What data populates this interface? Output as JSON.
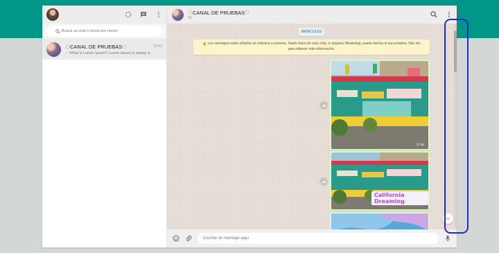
{
  "sidebar": {
    "search_placeholder": "Busca un chat o inicia uno nuevo",
    "chats": [
      {
        "title": "CANAL DE PRUEBAS",
        "time": "10:42",
        "preview": "What is Lorem Ipsum? Lorem Ipsum is simply d..."
      }
    ]
  },
  "conversation": {
    "title": "CANAL DE PRUEBAS",
    "subtitle": "Tú",
    "day_label": "MIÉRCOLES",
    "encryption_notice": "Los mensajes están cifrados de extremo a extremo. Nadie fuera de este chat, ni siquiera WhatsApp, puede leerlos ni escucharlos. Haz clic para obtener más información.",
    "images": [
      {
        "time": "17:55",
        "caption": "",
        "scene": "food-stand"
      },
      {
        "time": "",
        "caption": "California Dreaming",
        "scene": "food-stand"
      }
    ],
    "message_placeholder": "Escribe un mensaje aquí"
  },
  "icons": {
    "header": [
      "status-icon",
      "new-chat-icon",
      "menu-icon"
    ],
    "conversation": [
      "search-icon",
      "menu-icon"
    ],
    "footer": [
      "emoji-icon",
      "attach-icon",
      "microphone-icon"
    ]
  },
  "colors": {
    "brand": "#009688",
    "outgoing_bubble": "#dcf8c6",
    "encryption_notice_bg": "#fcf4cb",
    "annotation_outline": "#1d2bd4"
  }
}
